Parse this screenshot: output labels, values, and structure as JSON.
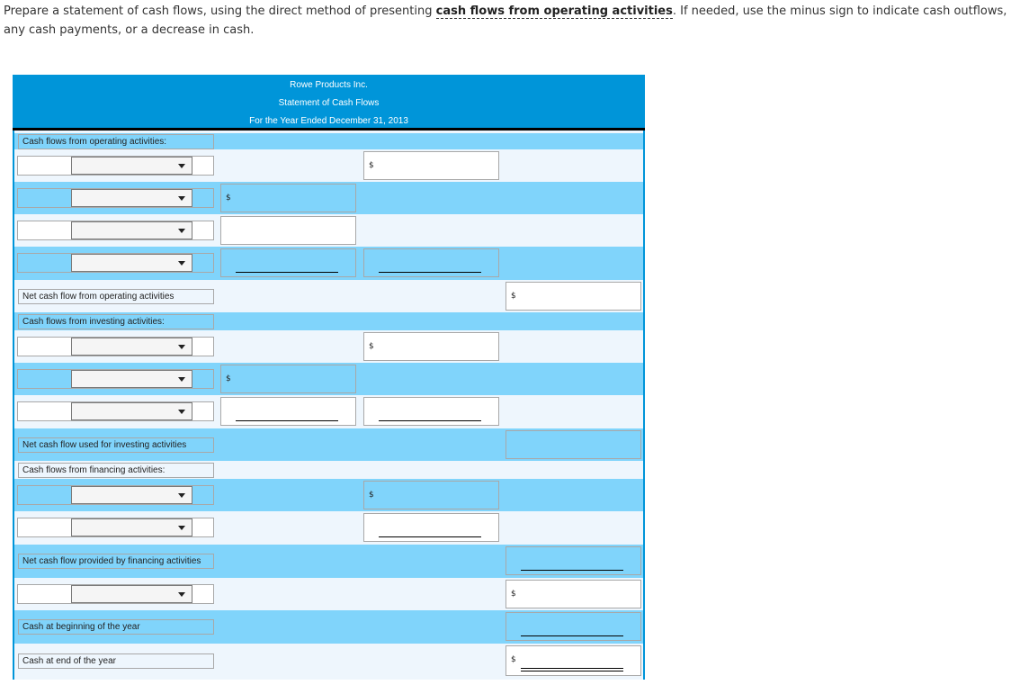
{
  "instructions": {
    "before": "Prepare a statement of cash flows, using the direct method of presenting ",
    "term": "cash flows from operating activities",
    "after": ". If needed, use the minus sign to indicate cash outflows, any cash payments, or a decrease in cash."
  },
  "statement": {
    "company": "Rowe Products Inc.",
    "title": "Statement of Cash Flows",
    "period": "For the Year Ended December 31, 2013"
  },
  "labels": {
    "operating_header": "Cash flows from operating activities:",
    "net_operating": "Net cash flow from operating activities",
    "investing_header": "Cash flows from investing activities:",
    "net_investing": "Net cash flow used for investing activities",
    "financing_header": "Cash flows from financing activities:",
    "net_financing": "Net cash flow provided by financing activities",
    "cash_beginning": "Cash at beginning of the year",
    "cash_end": "Cash at end of the year"
  },
  "currency_symbol": "$",
  "dropdowns": {
    "selected_value": ""
  },
  "colors": {
    "header_blue": "#0095d9",
    "row_dark": "#80d4fb",
    "row_light": "#eef6fd"
  }
}
